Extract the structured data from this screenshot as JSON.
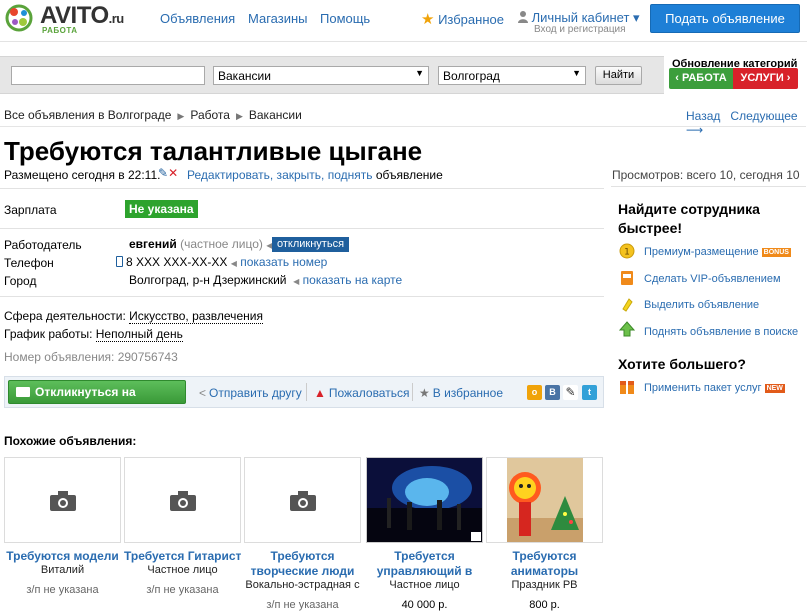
{
  "header": {
    "logo": "AVITO",
    "logo_domain": ".ru",
    "logo_sub": "РАБОТА",
    "nav": [
      "Объявления",
      "Магазины",
      "Помощь"
    ],
    "favorites": "Избранное",
    "cabinet": "Личный кабинет ▾",
    "cabinet_sub": "Вход и регистрация",
    "post_button": "Подать объявление"
  },
  "search": {
    "query": "",
    "category": "Вакансии",
    "city": "Волгоград",
    "find_button": "Найти"
  },
  "category_update": {
    "title": "Обновление категорий",
    "work": "‹ РАБОТА",
    "services": "УСЛУГИ ›"
  },
  "breadcrumbs": [
    "Все объявления в Волгограде",
    "Работа",
    "Вакансии"
  ],
  "nav_links": {
    "back": "Назад",
    "next": "Следующее ⟶"
  },
  "ad": {
    "title": "Требуются талантливые цыгане",
    "posted": "Размещено сегодня в 22:11.",
    "edit_link": "Редактировать, закрыть, поднять",
    "edit_suffix": "объявление",
    "views": "Просмотров: всего 10, сегодня 10",
    "salary_label": "Зарплата",
    "salary_value": "Не указана",
    "employer_label": "Работодатель",
    "employer_name": "евгений",
    "employer_type": "(частное лицо)",
    "respond_small": "откликнуться",
    "phone_label": "Телефон",
    "phone_value": "8 XXX XXX-XX-XX",
    "show_number": "показать номер",
    "city_label": "Город",
    "city_value": "Волгоград, р-н Дзержинский",
    "show_map": "показать на карте",
    "field_label": "Сфера деятельности:",
    "field_value": "Искусство, развлечения",
    "schedule_label": "График работы:",
    "schedule_value": "Неполный день",
    "ad_number": "Номер объявления: 290756743"
  },
  "actions": {
    "respond": "Откликнуться на вакансию",
    "send_friend": "Отправить другу",
    "complain": "Пожаловаться",
    "to_favorites": "В избранное"
  },
  "similar": {
    "title": "Похожие объявления:",
    "items": [
      {
        "title": "Требуются модели",
        "line1": "Виталий",
        "line2": "",
        "price": "з/п не указана"
      },
      {
        "title": "Требуется Гитарист",
        "line1": "Частное лицо",
        "line2": "",
        "price": "з/п не указана"
      },
      {
        "title": "Требуются",
        "line1": "творческие люди",
        "line2": "Вокально-эстрадная с",
        "price": "з/п не указана"
      },
      {
        "title": "Требуется",
        "line1": "управляющий в",
        "line2": "Частное лицо",
        "price": "40 000 р."
      },
      {
        "title": "Требуются",
        "line1": "аниматоры",
        "line2": "Праздник РВ",
        "price": "800 р."
      }
    ]
  },
  "sidebar": {
    "heading1": "Найдите сотрудника быстрее!",
    "premium": "Премиум-размещение",
    "premium_tag": "BONUS",
    "vip": "Сделать VIP-объявлением",
    "highlight": "Выделить объявление",
    "raise": "Поднять объявление в поиске",
    "heading2": "Хотите большего?",
    "package": "Применить пакет услуг",
    "package_tag": "NEW"
  },
  "colors": {
    "link": "#2a6cb0",
    "accent_green": "#3c9e3c",
    "accent_red": "#d8222a",
    "post_button": "#1e7fd6"
  }
}
